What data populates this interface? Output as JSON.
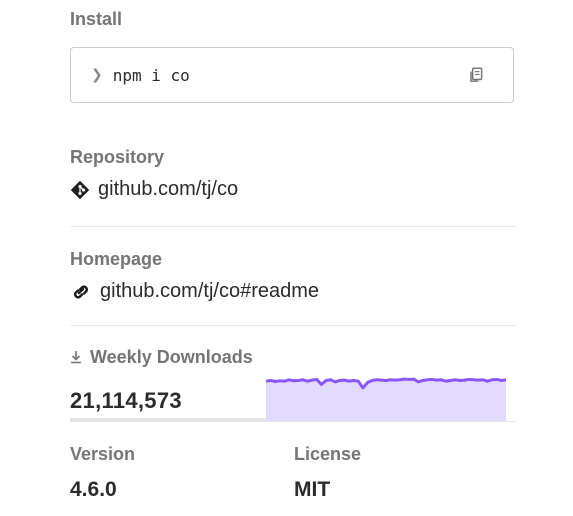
{
  "install": {
    "label": "Install",
    "prompt_icon": "chevron-right-icon",
    "command": "npm i co",
    "copy_icon": "copy-icon"
  },
  "repository": {
    "label": "Repository",
    "icon": "git-icon",
    "url_text": "github.com/tj/co"
  },
  "homepage": {
    "label": "Homepage",
    "icon": "link-icon",
    "url_text": "github.com/tj/co#readme"
  },
  "weekly_downloads": {
    "label": "Weekly Downloads",
    "icon": "download-icon",
    "count": "21,114,573",
    "sparkline": [
      0.62,
      0.6,
      0.63,
      0.61,
      0.62,
      0.58,
      0.61,
      0.6,
      0.58,
      0.62,
      0.59,
      0.57,
      0.72,
      0.6,
      0.58,
      0.64,
      0.6,
      0.59,
      0.62,
      0.6,
      0.62,
      0.82,
      0.66,
      0.6,
      0.58,
      0.59,
      0.6,
      0.58,
      0.59,
      0.58,
      0.56,
      0.57,
      0.56,
      0.64,
      0.6,
      0.58,
      0.57,
      0.59,
      0.58,
      0.62,
      0.6,
      0.58,
      0.6,
      0.59,
      0.57,
      0.58,
      0.59,
      0.58,
      0.62,
      0.58,
      0.57,
      0.6,
      0.58
    ],
    "spark_color": "#8956ff",
    "spark_fill": "#e3dbff"
  },
  "version": {
    "label": "Version",
    "value": "4.6.0"
  },
  "license": {
    "label": "License",
    "value": "MIT"
  }
}
